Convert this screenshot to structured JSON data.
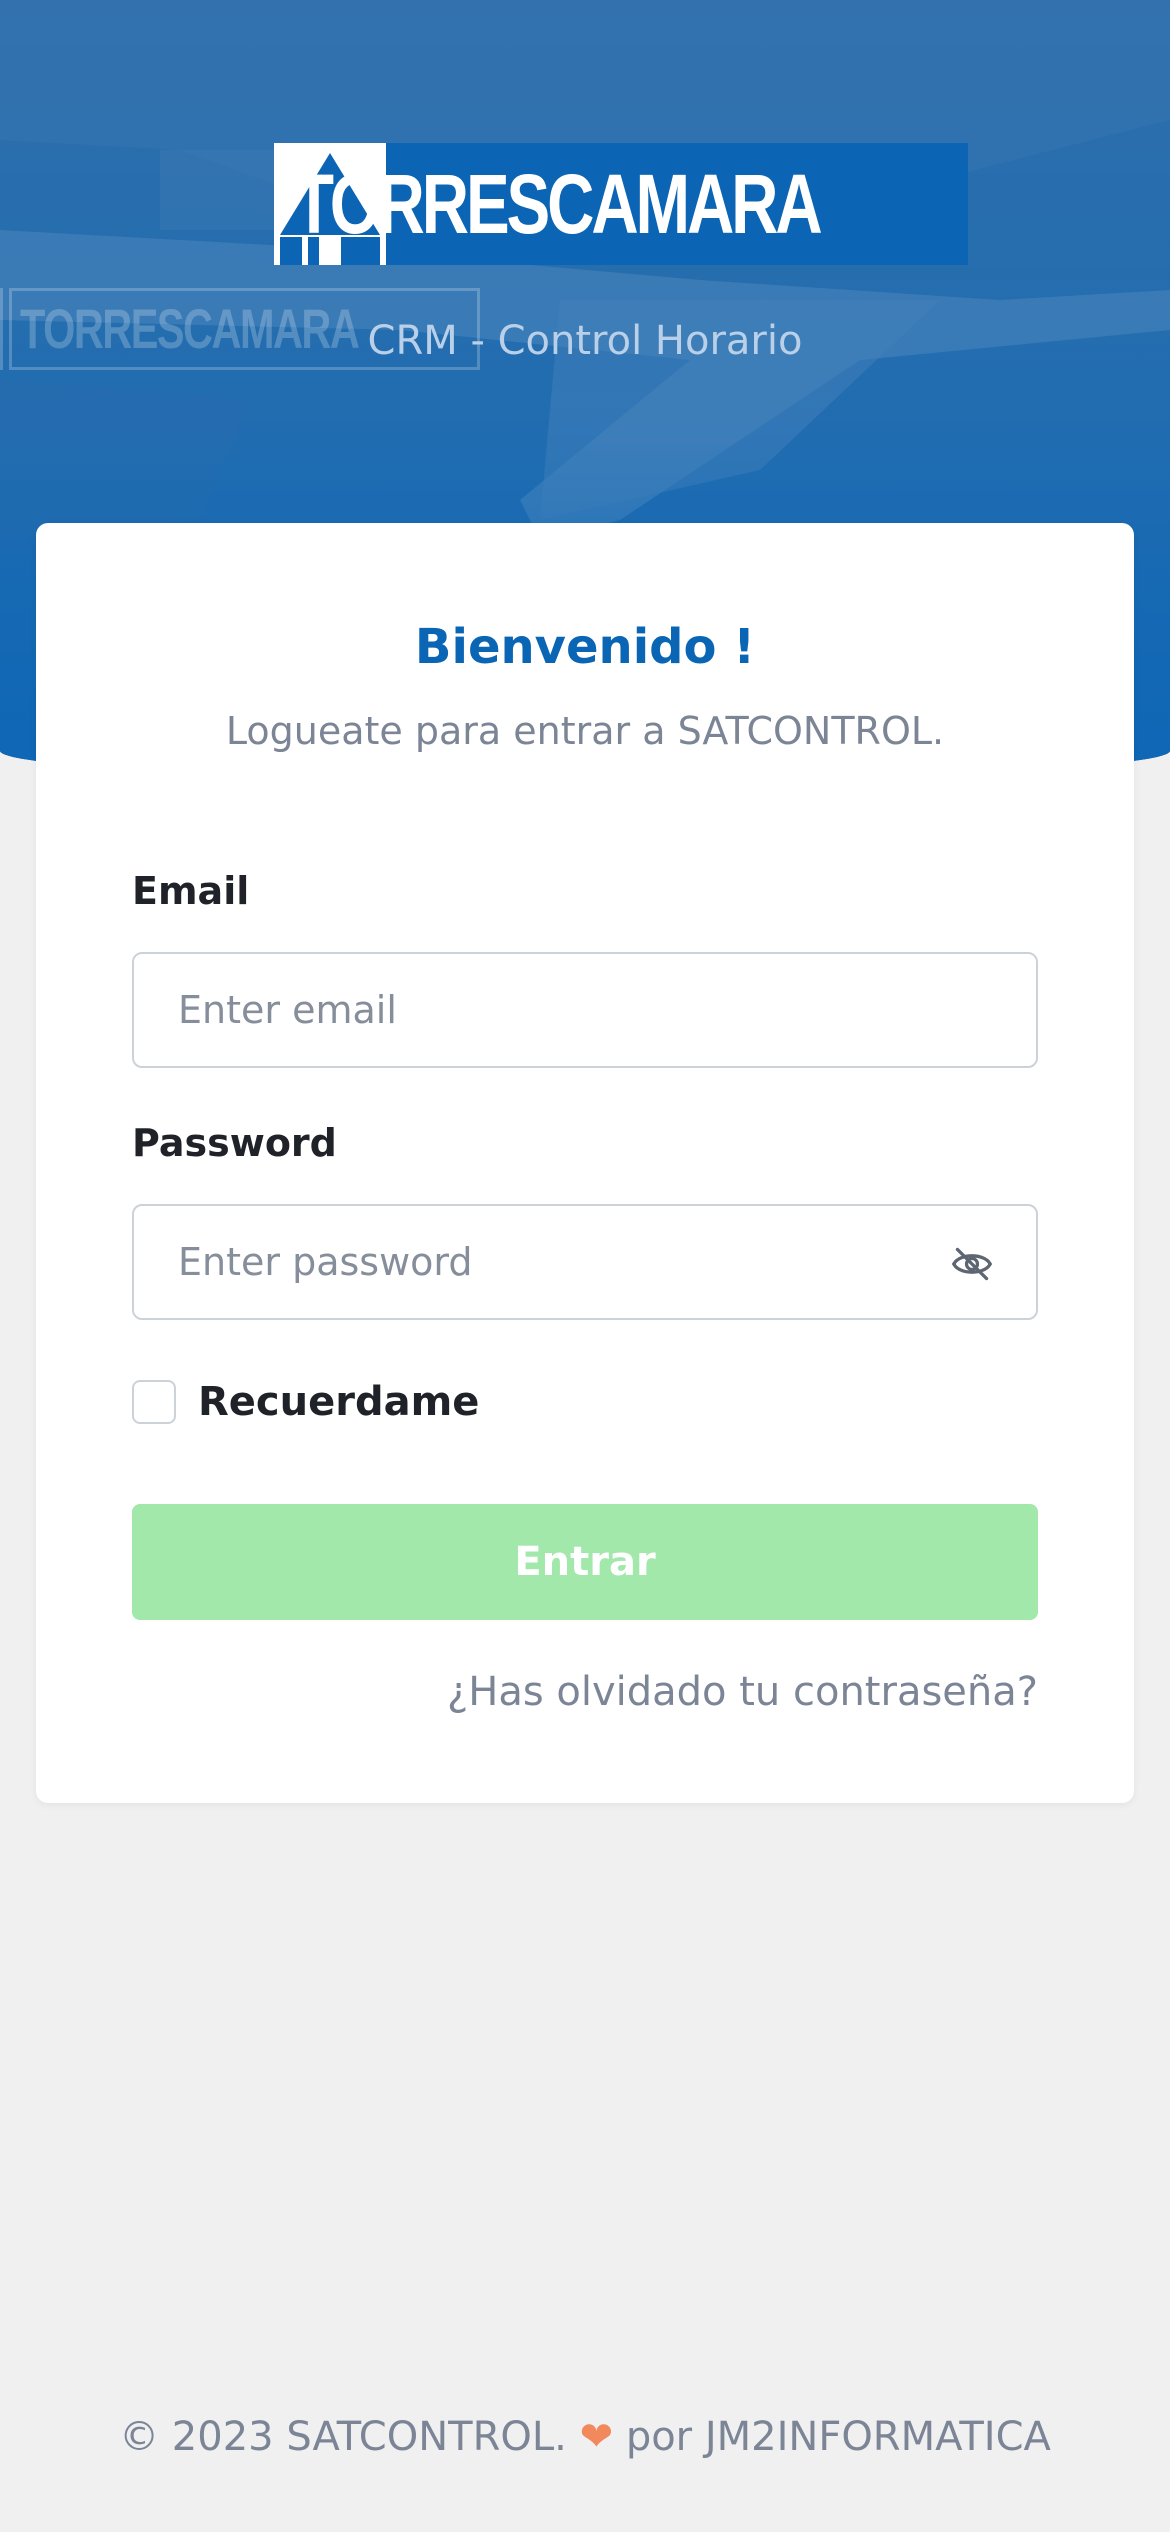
{
  "brand": {
    "logo_text": "TORRESCAMARA",
    "subtitle": "CRM - Control Horario"
  },
  "card": {
    "title": "Bienvenido !",
    "subtitle": "Logueate para entrar a SATCONTROL."
  },
  "form": {
    "email_label": "Email",
    "email_placeholder": "Enter email",
    "email_value": "",
    "password_label": "Password",
    "password_placeholder": "Enter password",
    "password_value": "",
    "password_visibility_icon": "eye-off-icon",
    "remember_label": "Recuerdame",
    "remember_checked": false,
    "submit_label": "Entrar",
    "forgot_label": "¿Has olvidado tu contraseña?"
  },
  "footer": {
    "prefix": "© 2023 SATCONTROL.",
    "heart": "❤",
    "suffix": "por JM2INFORMATICA"
  },
  "colors": {
    "primary": "#0a66b4",
    "submit_disabled": "#a2e8ab",
    "heart": "#f2895d",
    "page_bg": "#f0f0f1"
  }
}
